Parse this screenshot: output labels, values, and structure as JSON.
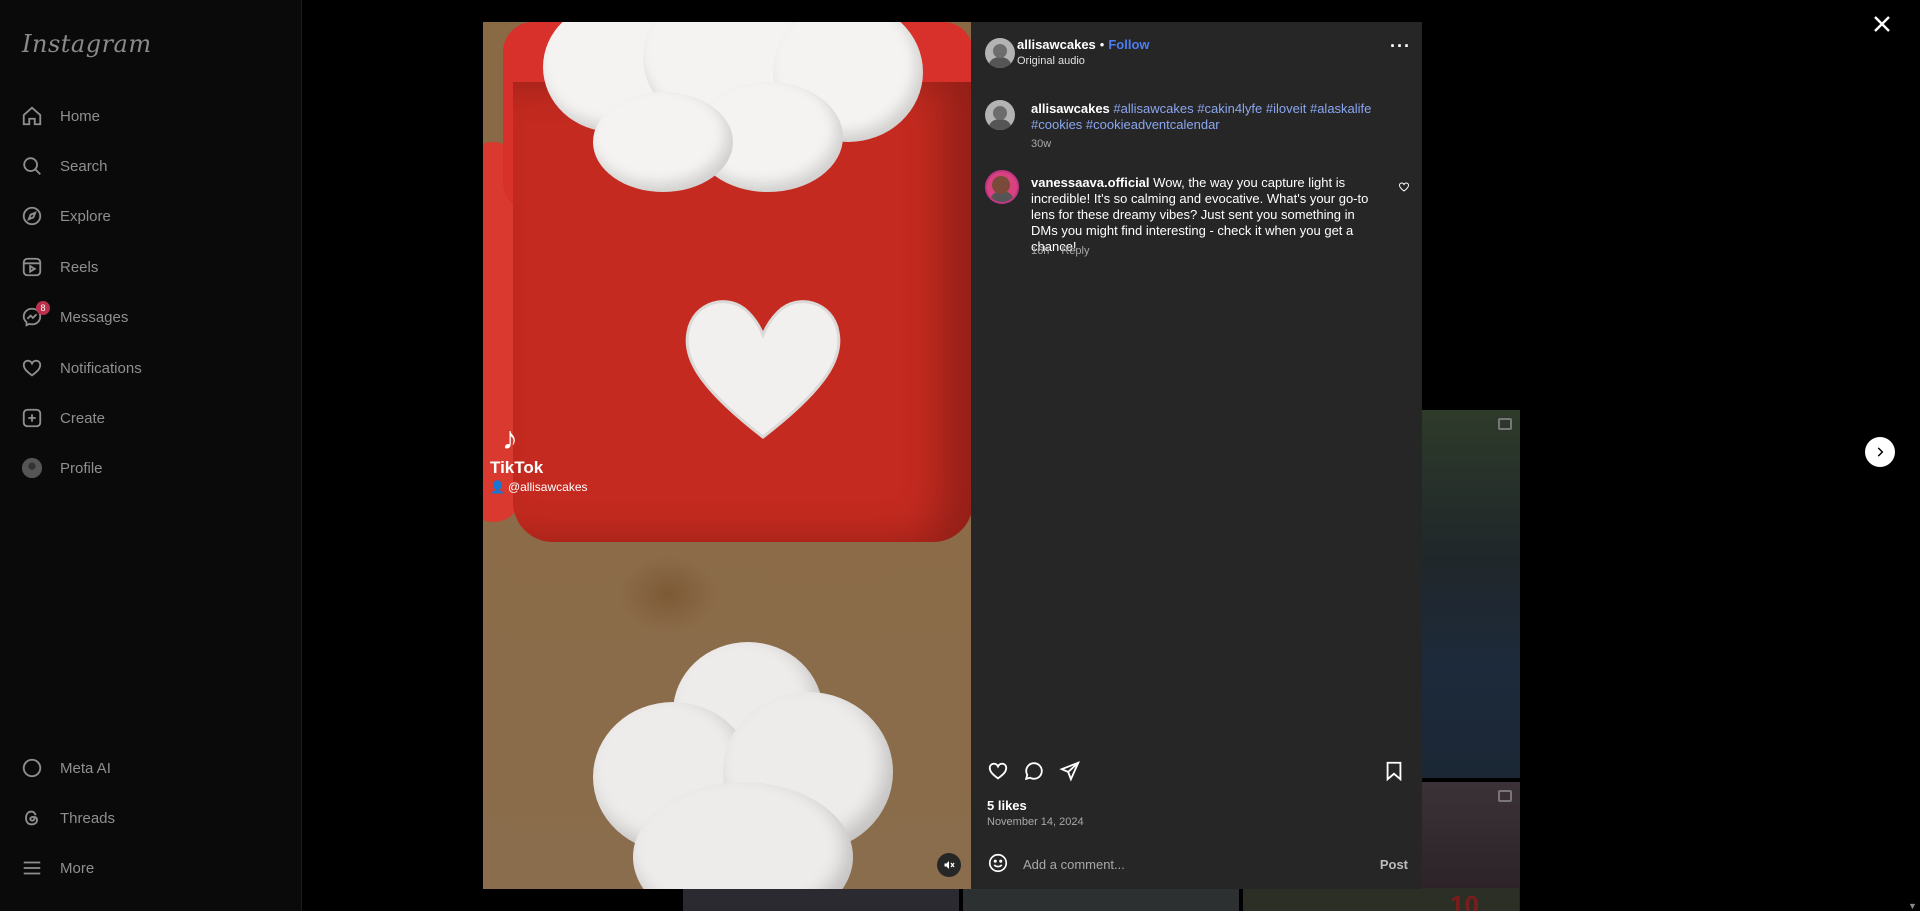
{
  "app": {
    "logo_text": "Instagram"
  },
  "sidebar": {
    "items": [
      {
        "label": "Home",
        "icon": "home-icon"
      },
      {
        "label": "Search",
        "icon": "search-icon"
      },
      {
        "label": "Explore",
        "icon": "compass-icon"
      },
      {
        "label": "Reels",
        "icon": "reels-icon"
      },
      {
        "label": "Messages",
        "icon": "messenger-icon",
        "badge": "8"
      },
      {
        "label": "Notifications",
        "icon": "heart-icon"
      },
      {
        "label": "Create",
        "icon": "plus-square-icon"
      },
      {
        "label": "Profile",
        "icon": "avatar-icon"
      }
    ],
    "bottom_items": [
      {
        "label": "Meta AI",
        "icon": "meta-ai-icon"
      },
      {
        "label": "Threads",
        "icon": "threads-icon"
      },
      {
        "label": "More",
        "icon": "menu-icon"
      }
    ]
  },
  "post": {
    "media": {
      "watermark_brand": "TikTok",
      "watermark_user": "@allisawcakes"
    },
    "header": {
      "username": "allisawcakes",
      "separator": "•",
      "follow_label": "Follow",
      "audio_label": "Original audio"
    },
    "caption": {
      "username": "allisawcakes",
      "hashtags": "#allisawcakes #cakin4lyfe #iloveit #alaskalife #cookies #cookieadventcalendar",
      "time": "30w"
    },
    "comments": [
      {
        "username": "vanessaava.official",
        "text": "Wow, the way you capture light is incredible! It's so calming and evocative. What's your go-to lens for these dreamy vibes? Just sent you something in DMs you might find interesting - check it when you get a chance!",
        "time": "16h",
        "reply_label": "Reply"
      }
    ],
    "likes": "5 likes",
    "date": "November 14, 2024",
    "comment_input": {
      "placeholder": "Add a comment...",
      "post_label": "Post"
    }
  },
  "background": {
    "tile_number": "10"
  },
  "colors": {
    "link": "#4c7df2",
    "hashtag": "#8aa6f0",
    "panel_bg": "#262626"
  }
}
